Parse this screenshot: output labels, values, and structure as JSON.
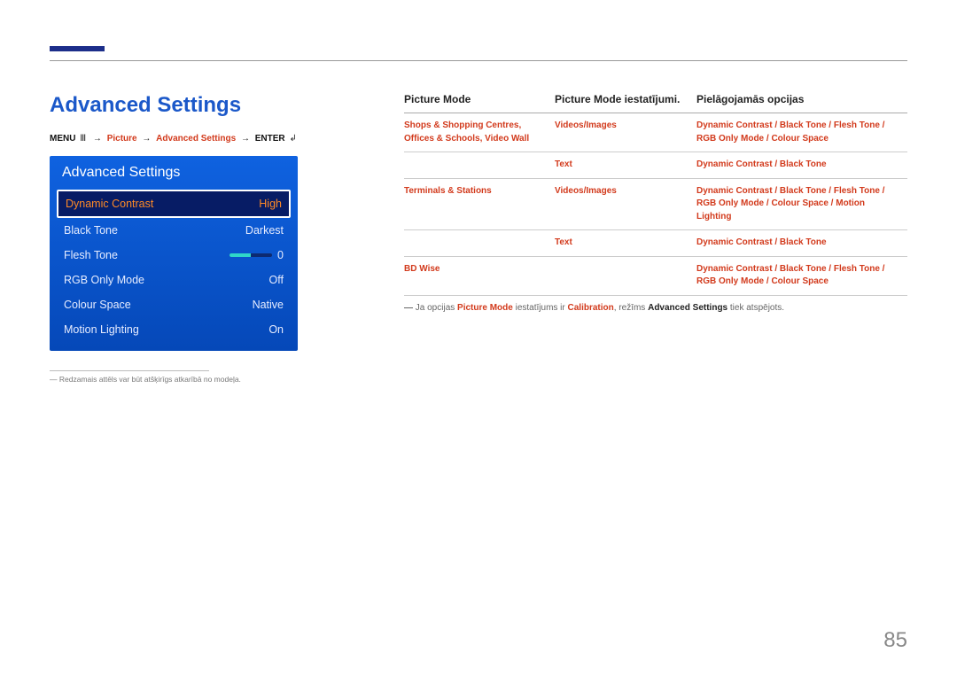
{
  "heading": "Advanced Settings",
  "breadcrumb": {
    "menu": "MENU",
    "menu_icon": "Ⅲ",
    "picture": "Picture",
    "advanced": "Advanced Settings",
    "enter": "ENTER",
    "enter_icon": "↲"
  },
  "panel": {
    "title": "Advanced Settings",
    "items": [
      {
        "label": "Dynamic Contrast",
        "value": "High",
        "selected": true
      },
      {
        "label": "Black Tone",
        "value": "Darkest",
        "selected": false
      },
      {
        "label": "Flesh Tone",
        "value": "0",
        "selected": false,
        "slider": true
      },
      {
        "label": "RGB Only Mode",
        "value": "Off",
        "selected": false
      },
      {
        "label": "Colour Space",
        "value": "Native",
        "selected": false
      },
      {
        "label": "Motion Lighting",
        "value": "On",
        "selected": false
      }
    ]
  },
  "footnote": "Redzamais attēls var būt atšķirīgs atkarībā no modeļa.",
  "table": {
    "headers": [
      "Picture Mode",
      "Picture Mode iestatījumi.",
      "Pielāgojamās opcijas"
    ],
    "rows": [
      {
        "c1": "Shops & Shopping Centres, Offices & Schools, Video Wall",
        "c2": "Videos/Images",
        "c3": "Dynamic Contrast / Black Tone / Flesh Tone / RGB Only Mode / Colour Space"
      },
      {
        "c1": "",
        "c2": "Text",
        "c3": "Dynamic Contrast / Black Tone"
      },
      {
        "c1": "Terminals & Stations",
        "c2": "Videos/Images",
        "c3": "Dynamic Contrast / Black Tone / Flesh Tone / RGB Only Mode / Colour Space / Motion Lighting"
      },
      {
        "c1": "",
        "c2": "Text",
        "c3": "Dynamic Contrast / Black Tone"
      },
      {
        "c1": "BD Wise",
        "c2": "",
        "c3": "Dynamic Contrast / Black Tone / Flesh Tone / RGB Only Mode / Colour Space"
      }
    ]
  },
  "note": {
    "pre": "Ja opcijas ",
    "em1": "Picture Mode",
    "mid1": " iestatījums ir ",
    "em2": "Calibration",
    "mid2": ", režīms ",
    "bold1": "Advanced Settings",
    "post": " tiek atspējots."
  },
  "page_number": "85"
}
